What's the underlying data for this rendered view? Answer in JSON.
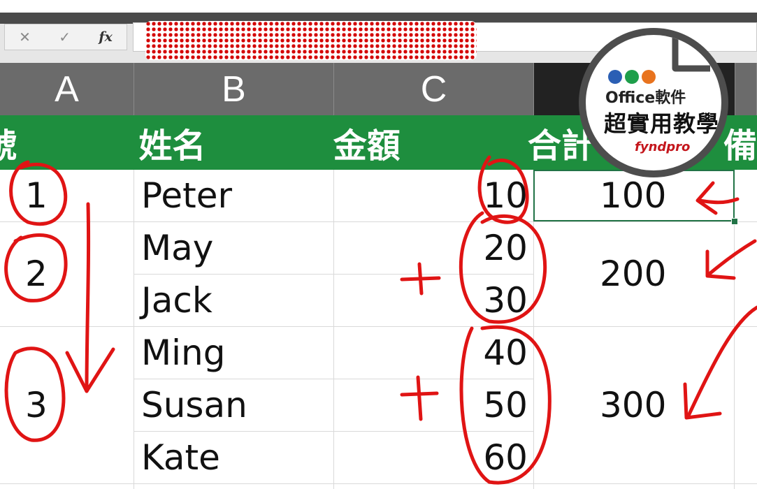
{
  "toolbar": {
    "cancel_glyph": "✕",
    "enter_glyph": "✓",
    "fx_label": "fx"
  },
  "columns": [
    {
      "letter": "A"
    },
    {
      "letter": "B"
    },
    {
      "letter": "C"
    },
    {
      "letter": ""
    },
    {
      "letter": ""
    }
  ],
  "header_row": {
    "col_a": "號",
    "col_b": "姓名",
    "col_c": "金額",
    "col_d": "合計",
    "col_e": "備"
  },
  "rows": [
    {
      "num": "1",
      "name": "Peter",
      "amount": "10"
    },
    {
      "num": "2",
      "name": "May",
      "amount": "20"
    },
    {
      "num": "",
      "name": "Jack",
      "amount": "30"
    },
    {
      "num": "",
      "name": "Ming",
      "amount": "40"
    },
    {
      "num": "3",
      "name": "Susan",
      "amount": "50"
    },
    {
      "num": "",
      "name": "Kate",
      "amount": "60"
    }
  ],
  "totals": [
    "100",
    "200",
    "300"
  ],
  "annotations": {
    "plus_1": "+",
    "plus_2": "+"
  },
  "logo": {
    "line1": "Office軟件",
    "line2": "超實用教學",
    "brand": "fyndpro",
    "dot_colors": [
      "#2b5fb4",
      "#1e9e4a",
      "#e8731e"
    ]
  },
  "colors": {
    "header_green": "#1e8e3e",
    "selection": "#217346",
    "annotation_red": "#e01414"
  }
}
